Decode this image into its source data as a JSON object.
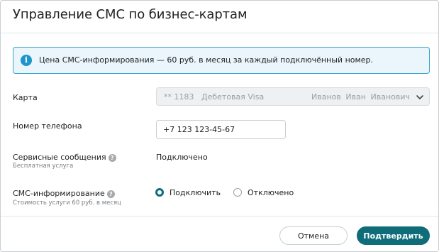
{
  "dialog": {
    "title": "Управление СМС по бизнес-картам"
  },
  "info": {
    "icon": "info-icon",
    "text": "Цена СМС-информирования — 60 руб. в месяц за каждый подключённый номер."
  },
  "card": {
    "label": "Карта",
    "number": "** 1183",
    "type": "Дебетовая Visa",
    "owner": "Иванов Иван Иванович",
    "icon": "chevron-down-icon"
  },
  "phone": {
    "label": "Номер телефона",
    "value": "+7 123 123-45-67"
  },
  "service": {
    "label": "Сервисные сообщения",
    "sublabel": "Бесплатная услуга",
    "status": "Подключено",
    "help": "?"
  },
  "sms": {
    "label": "СМС-информирование",
    "sublabel": "Стоимость услуги 60 руб. в месяц",
    "help": "?",
    "options": [
      {
        "label": "Подключить",
        "checked": true
      },
      {
        "label": "Отключено",
        "checked": false
      }
    ]
  },
  "footer": {
    "cancel_label": "Отмена",
    "confirm_label": "Подтвердить"
  },
  "colors": {
    "accent": "#0f6d7a",
    "info_border": "#36a2cf",
    "info_bg": "#eaf6fc"
  }
}
